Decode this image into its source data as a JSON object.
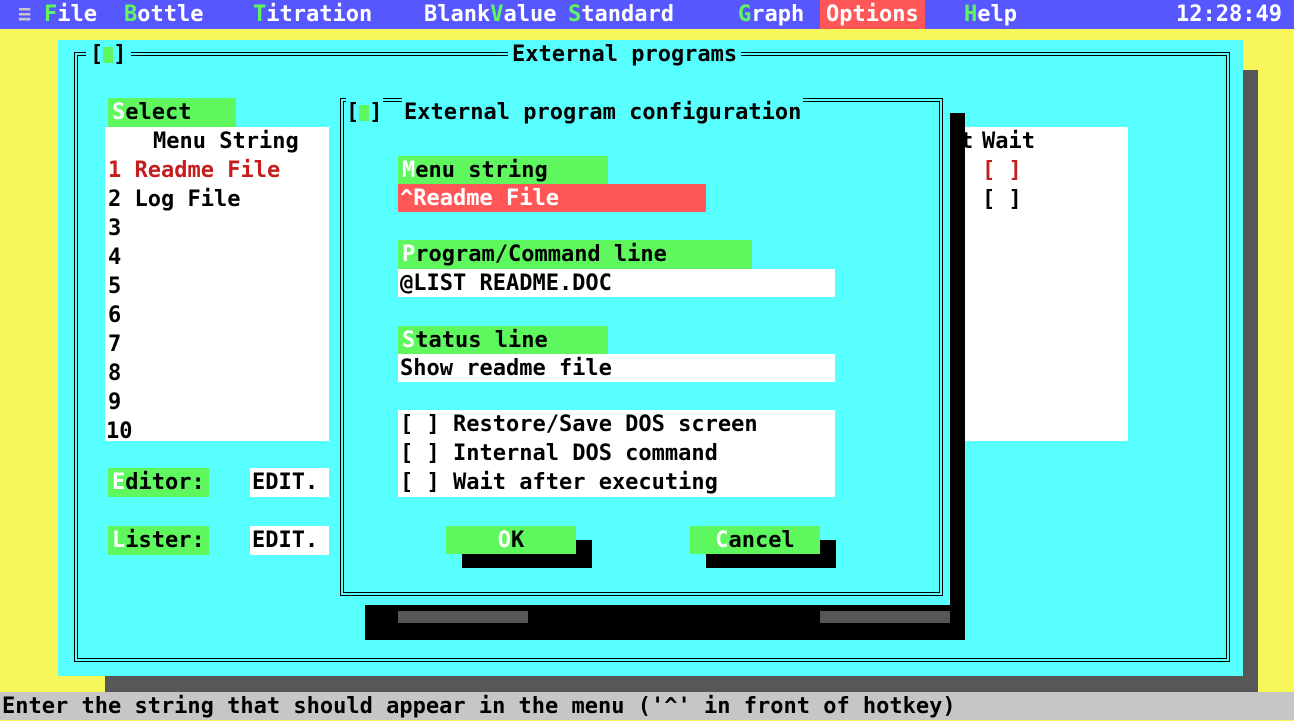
{
  "menubar": {
    "system_icon": "≡",
    "items": [
      {
        "hot": "F",
        "rest": "ile"
      },
      {
        "hot": "B",
        "rest": "ottle"
      },
      {
        "hot": "T",
        "rest": "itration"
      },
      {
        "hot": "",
        "rest": "Blank"
      },
      {
        "hot": "V",
        "rest": "alue"
      },
      {
        "hot": "S",
        "rest": "tandard"
      },
      {
        "hot": "G",
        "rest": "raph"
      },
      {
        "hot": "",
        "rest": "Options"
      },
      {
        "hot": "H",
        "rest": "elp"
      }
    ],
    "clock": "12:28:49"
  },
  "ext_window": {
    "title": "External programs",
    "select_label_hot": "S",
    "select_label_rest": "elect",
    "col_menu_string": "Menu String",
    "col_wait": "Wait",
    "col_partial": "t",
    "rows": [
      {
        "num": "1",
        "label": "Readme File",
        "wait": "[ ]",
        "bracket": "]"
      },
      {
        "num": "2",
        "label": "Log File",
        "wait": "[ ]",
        "bracket": "]"
      },
      {
        "num": "3",
        "label": ""
      },
      {
        "num": "4",
        "label": ""
      },
      {
        "num": "5",
        "label": ""
      },
      {
        "num": "6",
        "label": ""
      },
      {
        "num": "7",
        "label": ""
      },
      {
        "num": "8",
        "label": ""
      },
      {
        "num": "9",
        "label": ""
      },
      {
        "num": "10",
        "label": ""
      }
    ],
    "editor_label_hot": "E",
    "editor_label_rest": "ditor:",
    "editor_value": "EDIT.",
    "lister_label_hot": "L",
    "lister_label_rest": "ister:",
    "lister_value": "EDIT."
  },
  "dialog": {
    "title": "External program configuration",
    "menu_string_label_hot": "M",
    "menu_string_label_rest": "enu string",
    "menu_string_value": "^Readme File",
    "program_label_hot": "P",
    "program_label_rest": "rogram/Command line",
    "program_value": "@LIST README.DOC",
    "status_label_hot": "S",
    "status_label_rest": "tatus line",
    "status_value": "Show readme file",
    "checkboxes": [
      {
        "box": "[ ]",
        "label": "Restore/Save DOS screen"
      },
      {
        "box": "[ ]",
        "label": "Internal DOS command"
      },
      {
        "box": "[ ]",
        "label": "Wait after executing"
      }
    ],
    "ok_hot": "O",
    "ok_rest": "K",
    "cancel_hot": "C",
    "cancel_rest": "ancel"
  },
  "statusbar": {
    "text": "Enter the string that should appear in the menu ('^' in front of hotkey)"
  }
}
